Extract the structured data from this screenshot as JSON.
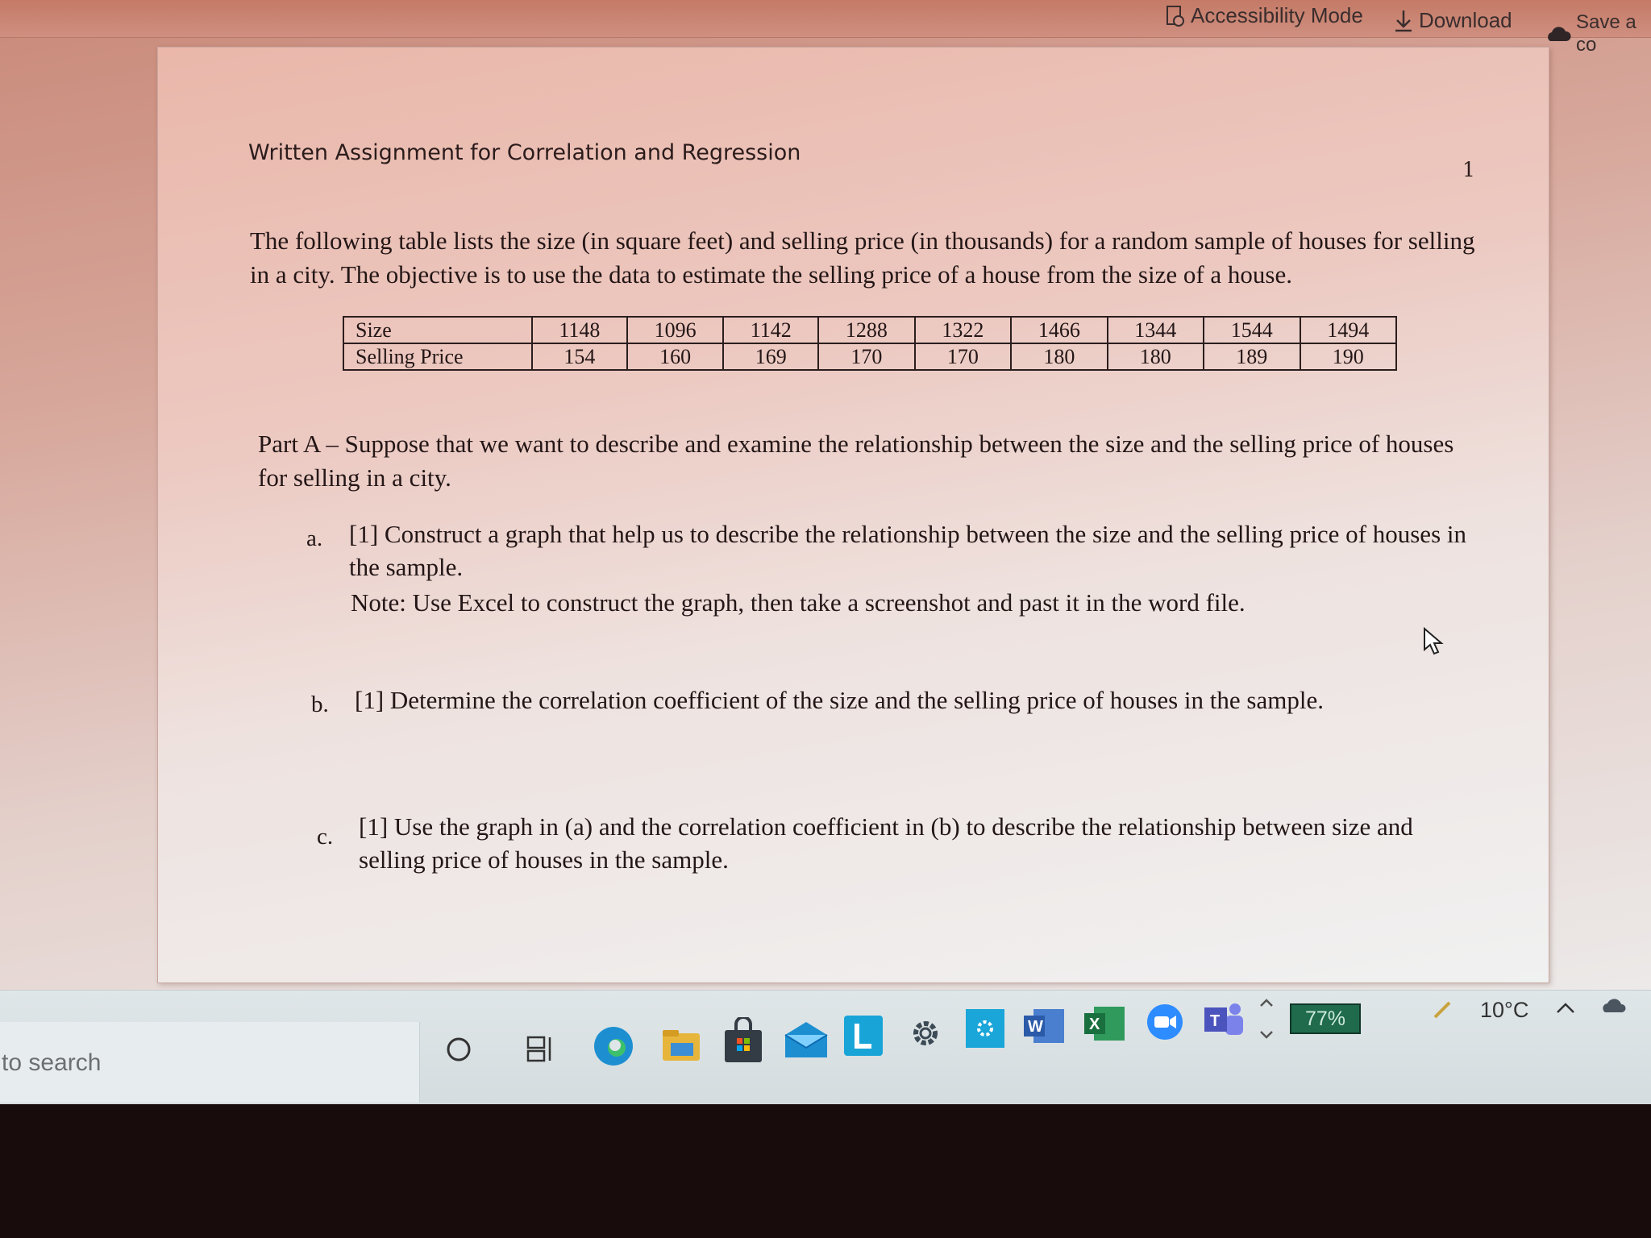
{
  "toolbar": {
    "accessibility_mode": "Accessibility Mode",
    "download": "Download",
    "save": "Save a co"
  },
  "document": {
    "header_title": "Written Assignment for Correlation and Regression",
    "page_number": "1",
    "intro": "The following table lists the size (in square feet) and selling price (in thousands) for a random sample of houses for selling in a city. The objective is to use the data to estimate the selling price of a house from the size of a house.",
    "table": {
      "rows": [
        {
          "label": "Size",
          "values": [
            "1148",
            "1096",
            "1142",
            "1288",
            "1322",
            "1466",
            "1344",
            "1544",
            "1494"
          ]
        },
        {
          "label": "Selling Price",
          "values": [
            "154",
            "160",
            "169",
            "170",
            "170",
            "180",
            "180",
            "189",
            "190"
          ]
        }
      ]
    },
    "part_a": "Part A – Suppose that we want to describe and examine the relationship between the size and the selling price of houses for selling in a city.",
    "questions": {
      "a_letter": "a.",
      "a_text": "[1] Construct a graph that help us to describe the relationship between the size and the selling price of houses in the sample.",
      "a_note": "Note: Use Excel to construct the graph, then take a screenshot and past it in the word file.",
      "b_letter": "b.",
      "b_text": "[1] Determine the correlation coefficient of the size and the selling price of houses in the sample.",
      "c_letter": "c.",
      "c_text": "[1] Use the graph in (a) and the correlation coefficient in (b) to describe the relationship between size and selling price of houses in the sample."
    }
  },
  "taskbar": {
    "search_text": "to search",
    "battery": "77%",
    "weather": "10°C",
    "icons": [
      "cortana-icon",
      "task-view-icon",
      "edge-icon",
      "file-explorer-icon",
      "store-icon",
      "mail-icon",
      "l-app-icon",
      "settings-icon",
      "control-panel-icon",
      "word-icon",
      "excel-icon",
      "zoom-icon",
      "teams-icon"
    ]
  }
}
